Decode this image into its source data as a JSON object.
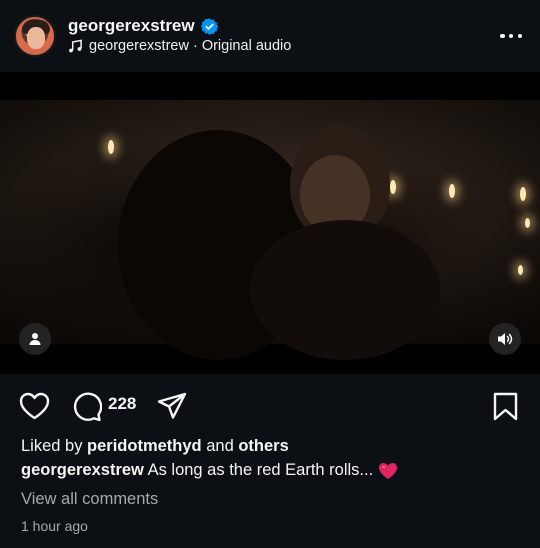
{
  "post": {
    "username": "georgerexstrew",
    "audio_label": "georgerexstrew · Original audio",
    "verified": true
  },
  "actions": {
    "comment_count": "228"
  },
  "likes": {
    "prefix": "Liked by ",
    "user": "peridotmethyd",
    "middle": " and ",
    "suffix": "others"
  },
  "caption": {
    "username": "georgerexstrew",
    "text": " As long as the red Earth rolls...",
    "emoji": "heart-emoji"
  },
  "view_comments": "View all comments",
  "timestamp": "1 hour ago",
  "colors": {
    "background": "#0c1014",
    "verified": "#0095f6",
    "secondary_text": "#a8a8a8",
    "heart_emoji": "#e0245e"
  }
}
